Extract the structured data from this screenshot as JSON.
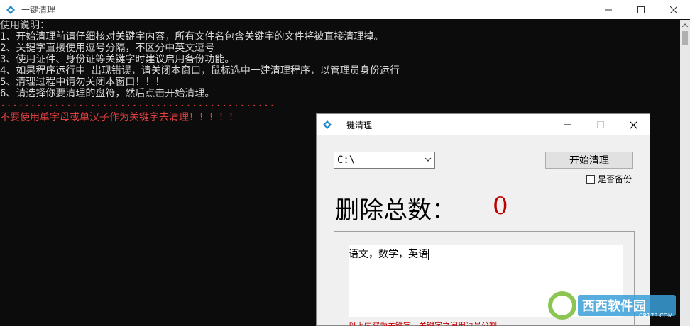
{
  "console": {
    "title": "一键清理",
    "lines": [
      "使用说明：",
      "1、开始清理前请仔细核对关键字内容，所有文件名包含关键字的文件将被直接清理掉。",
      "2、关键字直接使用逗号分隔，不区分中英文逗号",
      "3、使用证件、身份证等关键字时建议启用备份功能。",
      "4、如果程序运行中 出现错误，请关闭本窗口，鼠标选中一建清理程序，以管理员身份运行",
      "5、清理过程中请勿关闭本窗口！！！",
      "6、请选择你要清理的盘符，然后点击开始清理。"
    ],
    "separator": "··············································",
    "warning": "不要使用单字母或单汉子作为关键字去清理！！！！！",
    "text_color": "#d8d8d8",
    "warning_color": "#e04040"
  },
  "dialog": {
    "title": "一键清理",
    "drive_value": "C:\\",
    "start_label": "开始清理",
    "backup_label": "是否备份",
    "delete_label": "删除总数：",
    "delete_count": "0",
    "keywords": "语文，数学，英语",
    "hint": "以上内容为关键字，关键字之间用逗号分割。",
    "count_color": "#c00000"
  },
  "watermark": {
    "brand": "西西软件园",
    "site": "CR173.COM"
  }
}
